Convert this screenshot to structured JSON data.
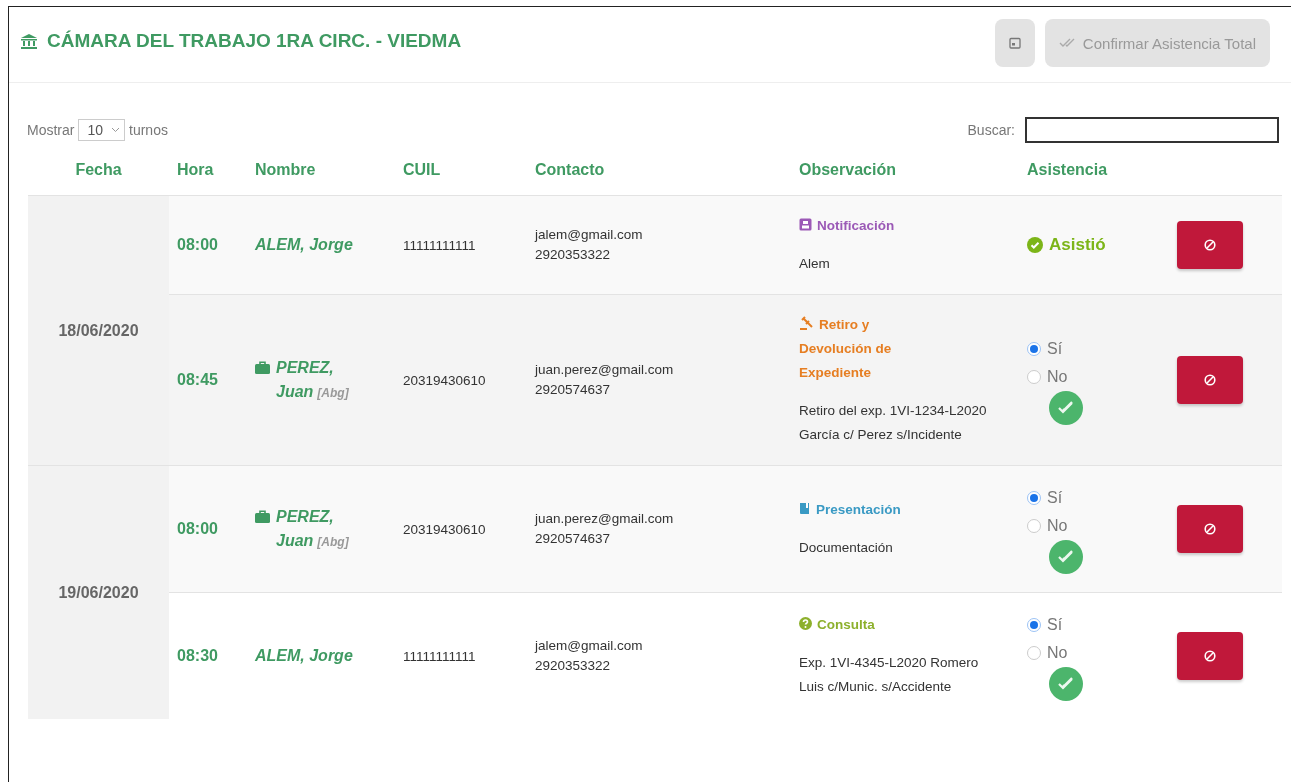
{
  "header": {
    "title": "CÁMARA DEL TRABAJO 1RA CIRC. - VIEDMA",
    "calendar_button": {
      "disabled": true
    },
    "confirm_button": {
      "label": "Confirmar Asistencia Total",
      "disabled": true
    }
  },
  "controls": {
    "show_label": "Mostrar",
    "page_size": "10",
    "show_suffix": "turnos",
    "search_label": "Buscar:"
  },
  "table": {
    "columns": [
      "Fecha",
      "Hora",
      "Nombre",
      "CUIL",
      "Contacto",
      "Observación",
      "Asistencia"
    ],
    "groups": [
      {
        "date": "18/06/2020",
        "rows": [
          {
            "time": "08:00",
            "name": "ALEM, Jorge",
            "lawyer": false,
            "cuil": "11111111111",
            "email": "jalem@gmail.com",
            "phone": "2920353322",
            "observation": {
              "kind": "notification",
              "title": "Notificación",
              "color": "#9b59b6",
              "detail": "Alem"
            },
            "attendance": {
              "kind": "status",
              "label": "Asistió"
            }
          },
          {
            "time": "08:45",
            "name": "PEREZ, Juan",
            "lawyer": true,
            "role": "[Abg]",
            "cuil": "20319430610",
            "email": "juan.perez@gmail.com",
            "phone": "2920574637",
            "observation": {
              "kind": "withdrawal",
              "title": "Retiro y Devolución de Expediente",
              "color": "#e67e22",
              "detail": "Retiro del exp. 1VI-1234-L2020 García c/ Perez s/Incidente"
            },
            "attendance": {
              "kind": "choice",
              "options": [
                {
                  "label": "Sí",
                  "selected": true
                },
                {
                  "label": "No",
                  "selected": false
                }
              ]
            }
          }
        ]
      },
      {
        "date": "19/06/2020",
        "rows": [
          {
            "time": "08:00",
            "name": "PEREZ, Juan",
            "lawyer": true,
            "role": "[Abg]",
            "cuil": "20319430610",
            "email": "juan.perez@gmail.com",
            "phone": "2920574637",
            "observation": {
              "kind": "filing",
              "title": "Presentación",
              "color": "#3a9ac4",
              "detail": "Documentación"
            },
            "attendance": {
              "kind": "choice",
              "options": [
                {
                  "label": "Sí",
                  "selected": true
                },
                {
                  "label": "No",
                  "selected": false
                }
              ]
            }
          },
          {
            "time": "08:30",
            "name": "ALEM, Jorge",
            "lawyer": false,
            "cuil": "11111111111",
            "email": "jalem@gmail.com",
            "phone": "2920353322",
            "observation": {
              "kind": "inquiry",
              "title": "Consulta",
              "color": "#8db02c",
              "detail": "Exp. 1VI-4345-L2020 Romero Luis c/Munic. s/Accidente"
            },
            "attendance": {
              "kind": "choice",
              "options": [
                {
                  "label": "Sí",
                  "selected": true
                },
                {
                  "label": "No",
                  "selected": false
                }
              ]
            }
          }
        ]
      }
    ]
  }
}
